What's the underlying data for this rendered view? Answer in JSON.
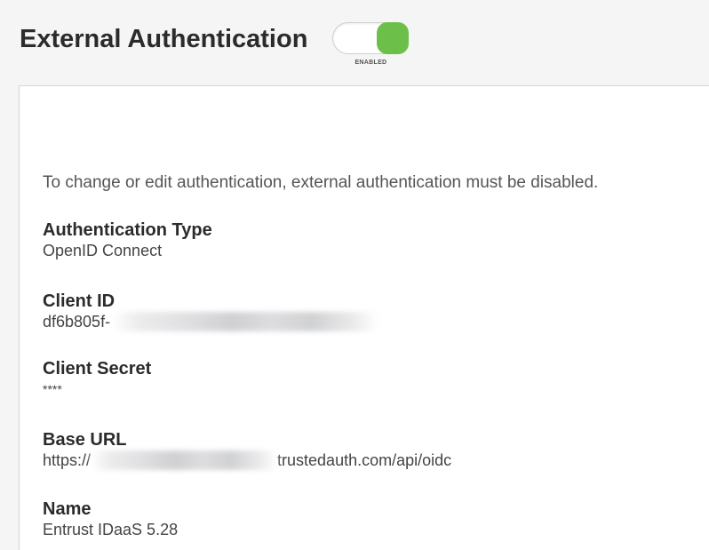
{
  "header": {
    "title": "External Authentication",
    "toggle_label": "ENABLED",
    "toggle_state": "on"
  },
  "notice": "To change or edit authentication, external authentication must be disabled.",
  "fields": {
    "auth_type": {
      "label": "Authentication Type",
      "value": "OpenID Connect"
    },
    "client_id": {
      "label": "Client ID",
      "value_prefix": "df6b805f-"
    },
    "client_secret": {
      "label": "Client Secret",
      "value": "****"
    },
    "base_url": {
      "label": "Base URL",
      "value_prefix": "https://",
      "value_suffix": "trustedauth.com/api/oidc"
    },
    "name": {
      "label": "Name",
      "value": "Entrust IDaaS 5.28"
    }
  },
  "colors": {
    "toggle_on": "#6cc04a",
    "background": "#f5f5f5",
    "panel": "#ffffff"
  }
}
